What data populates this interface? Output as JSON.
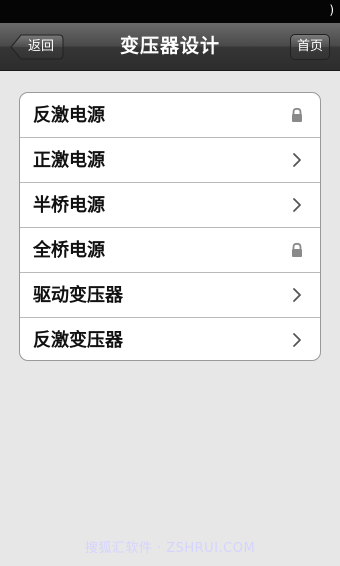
{
  "status_bar": {
    "glyph": ")"
  },
  "nav": {
    "title": "变压器设计",
    "back_label": "返回",
    "home_label": "首页"
  },
  "menu": {
    "items": [
      {
        "label": "反激电源",
        "icon": "lock-icon"
      },
      {
        "label": "正激电源",
        "icon": "chevron-right-icon"
      },
      {
        "label": "半桥电源",
        "icon": "chevron-right-icon"
      },
      {
        "label": "全桥电源",
        "icon": "lock-icon"
      },
      {
        "label": "驱动变压器",
        "icon": "chevron-right-icon"
      },
      {
        "label": "反激变压器",
        "icon": "chevron-right-icon"
      }
    ]
  },
  "watermark": {
    "text": "搜狐汇软件 · ZSHRUI.COM"
  },
  "colors": {
    "background": "#e7e7e7",
    "nav_dark": "#2d2d2d",
    "card": "#ffffff",
    "icon_gray": "#8a8a8a"
  }
}
